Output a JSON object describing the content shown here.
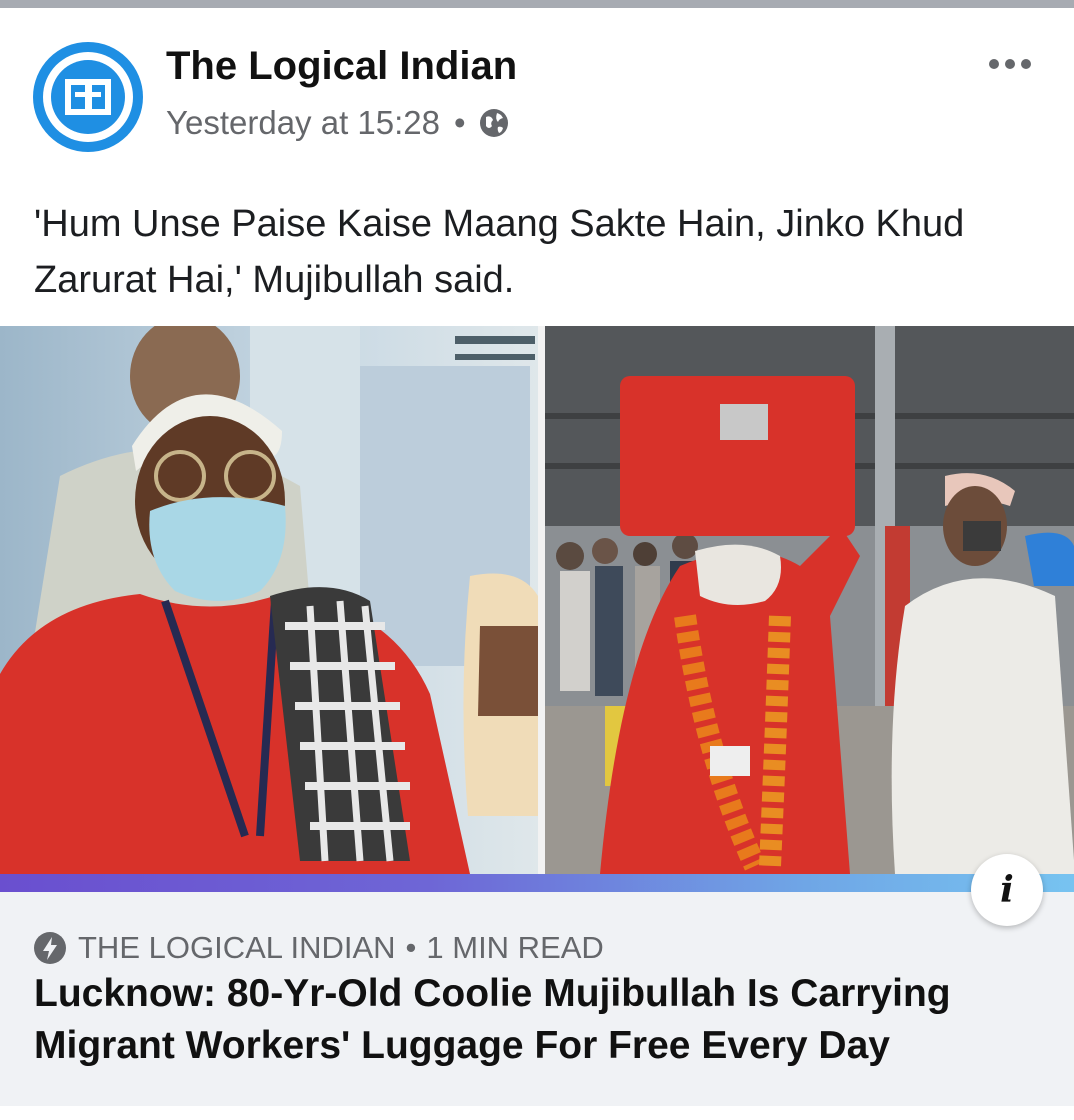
{
  "post": {
    "page_name": "The Logical Indian",
    "timestamp": "Yesterday at 15:28",
    "separator": "•",
    "audience_icon": "globe-icon",
    "more_icon": "more-options-icon",
    "caption": "'Hum Unse Paise Kaise Maang Sakte Hain, Jinko Khud Zarurat Hai,' Mujibullah said."
  },
  "link_preview": {
    "source": "THE LOGICAL INDIAN",
    "separator": "•",
    "read_time": "1 MIN READ",
    "headline": "Lucknow: 80-Yr-Old Coolie Mujibullah Is Carrying Migrant Workers' Luggage For Free Every Day",
    "info_label": "i",
    "source_icon": "lightning-bolt-icon"
  },
  "colors": {
    "brand_blue": "#1f8fe3",
    "secondary_text": "#65676b",
    "preview_background": "#f0f2f5",
    "coat_red": "#d8322a"
  }
}
